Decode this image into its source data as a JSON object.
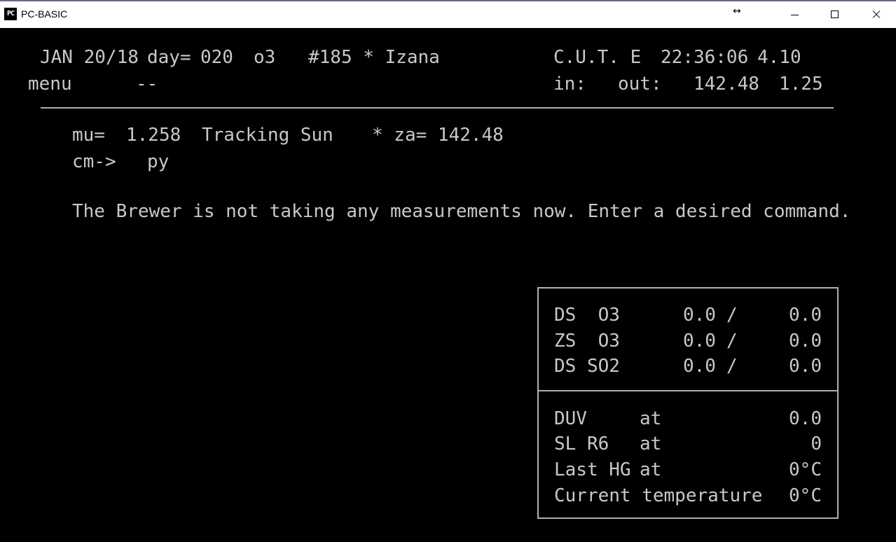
{
  "window": {
    "title": "PC-BASIC",
    "icon_label": "PC",
    "resize_glyph": "↔"
  },
  "header": {
    "date": "JAN 20/18",
    "day_label": "day=",
    "day_value": "020",
    "o3": "o3",
    "station": "#185 * Izana",
    "cut": "C.U.T. E",
    "time": "22:36:06",
    "version": "4.10",
    "menu": "menu",
    "menu_value": "--",
    "in_label": "in:",
    "out_label": "out:",
    "out_value": "142.48",
    "out_value2": "1.25"
  },
  "status": {
    "mu_label": "mu=",
    "mu_value": "1.258",
    "tracking": "Tracking Sun",
    "za": "* za= 142.48",
    "cm_prompt": "cm->",
    "cm_value": "py",
    "message": "The Brewer is not taking any measurements now. Enter a desired command."
  },
  "panel": {
    "rows_top": [
      {
        "label": "DS  O3",
        "v1": "0.0",
        "sep": "/",
        "v2": "0.0"
      },
      {
        "label": "ZS  O3",
        "v1": "0.0",
        "sep": "/",
        "v2": "0.0"
      },
      {
        "label": "DS SO2",
        "v1": "0.0",
        "sep": "/",
        "v2": "0.0"
      }
    ],
    "rows_bottom": [
      {
        "label": "DUV",
        "at": "at",
        "value": "0.0"
      },
      {
        "label": "SL R6",
        "at": "at",
        "value": "0"
      },
      {
        "label": "Last HG",
        "at": "at",
        "value": "0°C"
      },
      {
        "label": "Current temperature",
        "at": "",
        "value": "0°C"
      }
    ]
  }
}
